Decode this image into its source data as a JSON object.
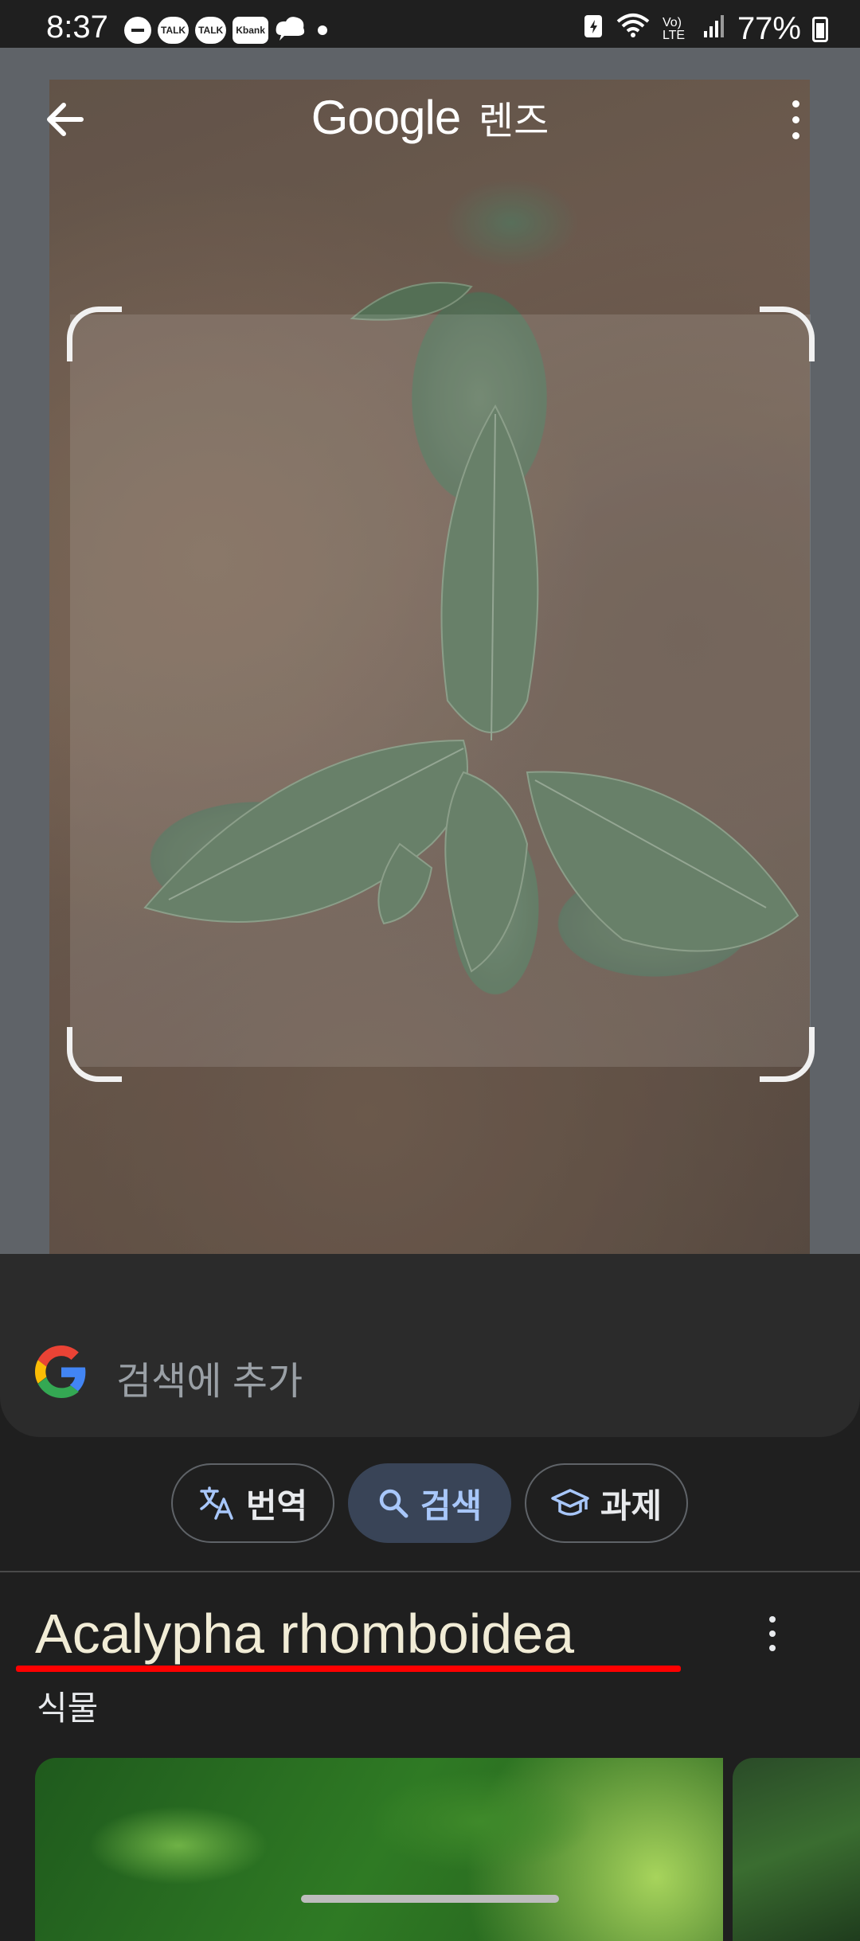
{
  "status_bar": {
    "time": "8:37",
    "notification_icons": [
      "do-not-disturb-icon",
      "TALK",
      "TALK",
      "Kbank",
      "cloud-chat-icon"
    ],
    "network_label": "Vo) LTE",
    "battery_percent": "77%"
  },
  "header": {
    "brand": "Google",
    "product": "렌즈"
  },
  "search_add": {
    "label": "검색에 추가"
  },
  "chips": {
    "translate": "번역",
    "search": "검색",
    "homework": "과제",
    "selected": "search"
  },
  "result": {
    "title": "Acalypha rhomboidea",
    "subtitle": "식물"
  },
  "colors": {
    "accent_selected_chip": "#394457",
    "selected_chip_text": "#a8c7fa",
    "underline": "#ff0000",
    "title_text": "#f1ecd6"
  }
}
